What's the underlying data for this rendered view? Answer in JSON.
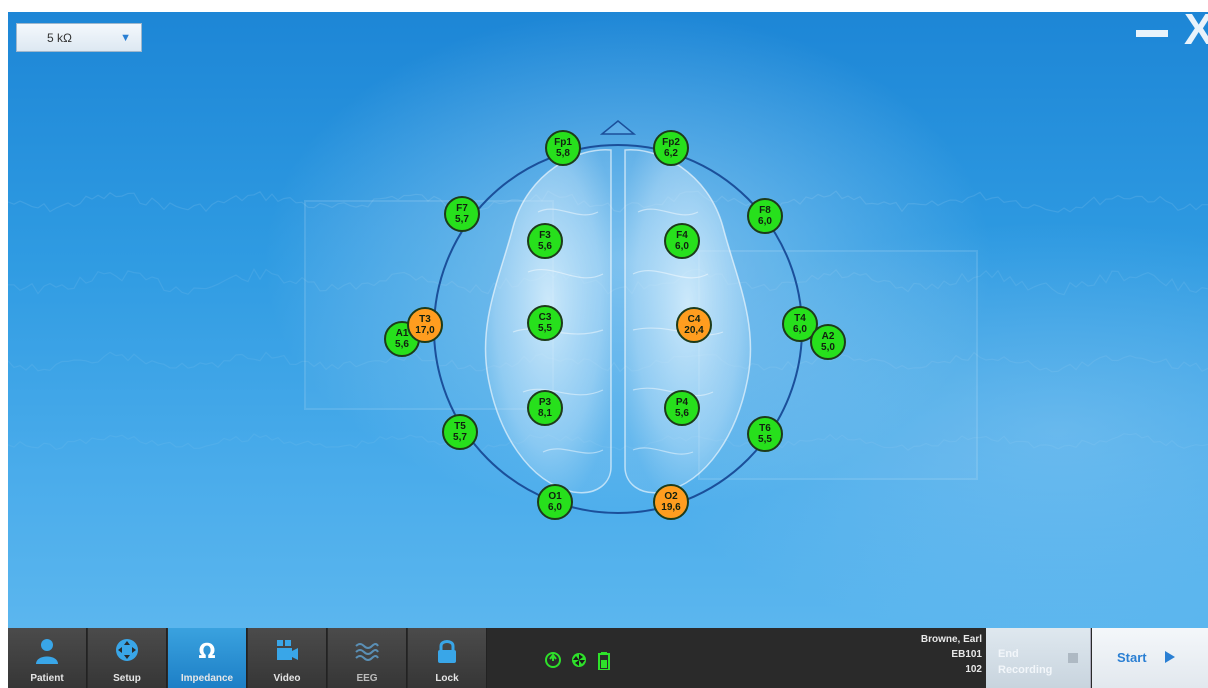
{
  "threshold": {
    "value": "5 kΩ"
  },
  "electrodes": [
    {
      "id": "Fp1",
      "value": "5,8",
      "status": "ok"
    },
    {
      "id": "Fp2",
      "value": "6,2",
      "status": "ok"
    },
    {
      "id": "F7",
      "value": "5,7",
      "status": "ok"
    },
    {
      "id": "F8",
      "value": "6,0",
      "status": "ok"
    },
    {
      "id": "F3",
      "value": "5,6",
      "status": "ok"
    },
    {
      "id": "F4",
      "value": "6,0",
      "status": "ok"
    },
    {
      "id": "A1",
      "value": "5,6",
      "status": "ok"
    },
    {
      "id": "T3",
      "value": "17,0",
      "status": "warn"
    },
    {
      "id": "C3",
      "value": "5,5",
      "status": "ok"
    },
    {
      "id": "C4",
      "value": "20,4",
      "status": "warn"
    },
    {
      "id": "T4",
      "value": "6,0",
      "status": "ok"
    },
    {
      "id": "A2",
      "value": "5,0",
      "status": "ok"
    },
    {
      "id": "P3",
      "value": "8,1",
      "status": "ok"
    },
    {
      "id": "P4",
      "value": "5,6",
      "status": "ok"
    },
    {
      "id": "T5",
      "value": "5,7",
      "status": "ok"
    },
    {
      "id": "T6",
      "value": "5,5",
      "status": "ok"
    },
    {
      "id": "O1",
      "value": "6,0",
      "status": "ok"
    },
    {
      "id": "O2",
      "value": "19,6",
      "status": "warn"
    }
  ],
  "colors": {
    "ok": "#27e01c",
    "warn": "#ff9d1f",
    "accent": "#1d7fc6"
  },
  "toolbar": {
    "tools": [
      {
        "label": "Patient",
        "icon": "person-icon"
      },
      {
        "label": "Setup",
        "icon": "setup-icon"
      },
      {
        "label": "Impedance",
        "icon": "omega-icon",
        "active": true
      },
      {
        "label": "Video",
        "icon": "video-camera-icon"
      },
      {
        "label": "EEG",
        "icon": "waves-icon"
      },
      {
        "label": "Lock",
        "icon": "lock-icon"
      }
    ],
    "status_icons": [
      "power-icon",
      "pinwheel-icon",
      "battery-icon"
    ],
    "patient_name": "Browne, Earl",
    "patient_id": "EB101",
    "patient_code": "102",
    "end_recording_line1": "End",
    "end_recording_line2": "Recording",
    "start_label": "Start"
  }
}
